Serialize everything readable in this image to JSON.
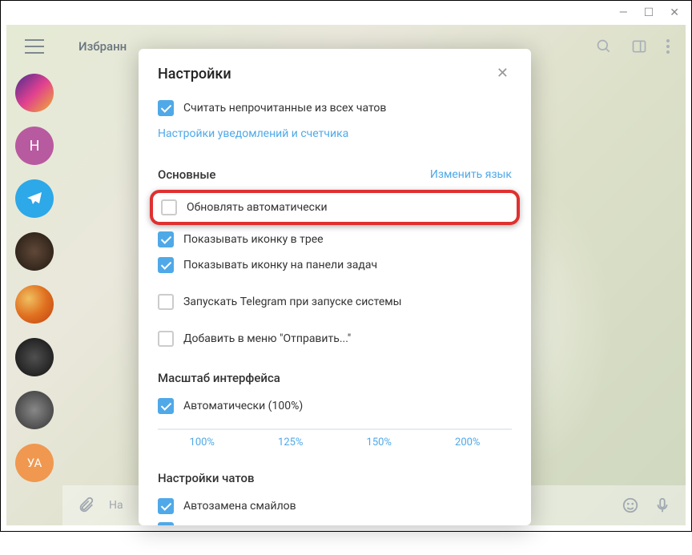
{
  "window": {
    "minimize": "—",
    "maximize": "☐",
    "close": "✕"
  },
  "header": {
    "chat_title": "Избранн"
  },
  "modal": {
    "title": "Настройки",
    "close": "✕",
    "unread_checkbox": "Считать непрочитанные из всех чатов",
    "notif_link": "Настройки уведомлений и счетчика",
    "section_general": "Основные",
    "change_lang": "Изменить язык",
    "auto_update": "Обновлять автоматически",
    "tray_icon": "Показывать иконку в трее",
    "taskbar_icon": "Показывать иконку на панели задач",
    "autostart": "Запускать Telegram при запуске системы",
    "send_to": "Добавить в меню \"Отправить...\"",
    "scale_title": "Масштаб интерфейса",
    "scale_auto": "Автоматически (100%)",
    "scale_options": {
      "a": "100%",
      "b": "125%",
      "c": "150%",
      "d": "200%"
    },
    "chats_title": "Настройки чатов",
    "emoji_replace": "Автозамена смайлов"
  },
  "colors": {
    "av1": "linear-gradient(135deg,#4a2d8f,#e04090,#f0b030)",
    "av2": "#b85aa0",
    "av3": "#2da8e8",
    "av4": "radial-gradient(circle,#604838,#201810)",
    "av5": "radial-gradient(circle at 35% 35%,#f0c060,#e07020,#c04010)",
    "av6": "radial-gradient(circle,#505050,#101010)",
    "av7": "radial-gradient(circle,#888,#333)",
    "av8": "#f09850",
    "avH": "Н",
    "avUA": "УА"
  },
  "input": {
    "placeholder": "На"
  }
}
